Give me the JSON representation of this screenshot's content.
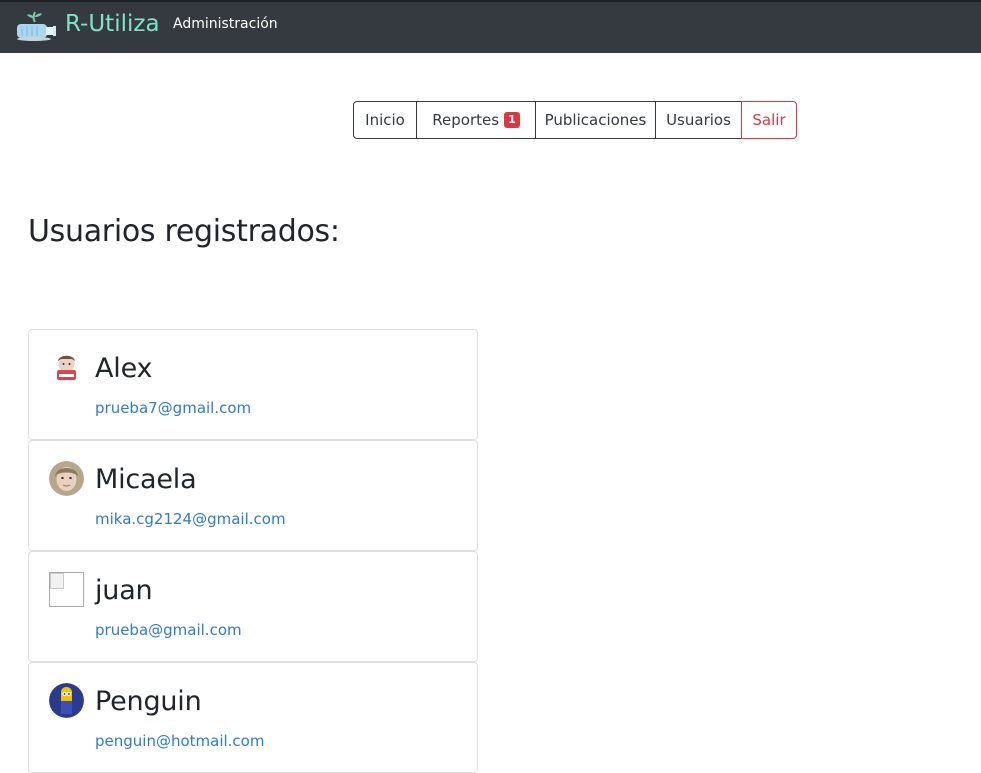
{
  "navbar": {
    "brand": "R-Utiliza",
    "admin_link": "Administración",
    "logo_icon": "recycle-bottle-plant-icon",
    "background": "#343a40",
    "brand_color": "#7fe3c7"
  },
  "nav_buttons": {
    "inicio": "Inicio",
    "reportes": "Reportes",
    "reportes_badge": "1",
    "publicaciones": "Publicaciones",
    "usuarios": "Usuarios",
    "salir": "Salir"
  },
  "main": {
    "title": "Usuarios registrados:"
  },
  "users": [
    {
      "name": "Alex",
      "email": "prueba7@gmail.com",
      "avatar": "cartoon-avatar-icon"
    },
    {
      "name": "Micaela",
      "email": "mika.cg2124@gmail.com",
      "avatar": "photo-avatar-icon"
    },
    {
      "name": "juan",
      "email": "prueba@gmail.com",
      "avatar": "broken-image-icon"
    },
    {
      "name": "Penguin",
      "email": "penguin@hotmail.com",
      "avatar": "cartoon-avatar-icon"
    }
  ],
  "colors": {
    "danger": "#dc3545",
    "link": "#2e7bcf"
  }
}
